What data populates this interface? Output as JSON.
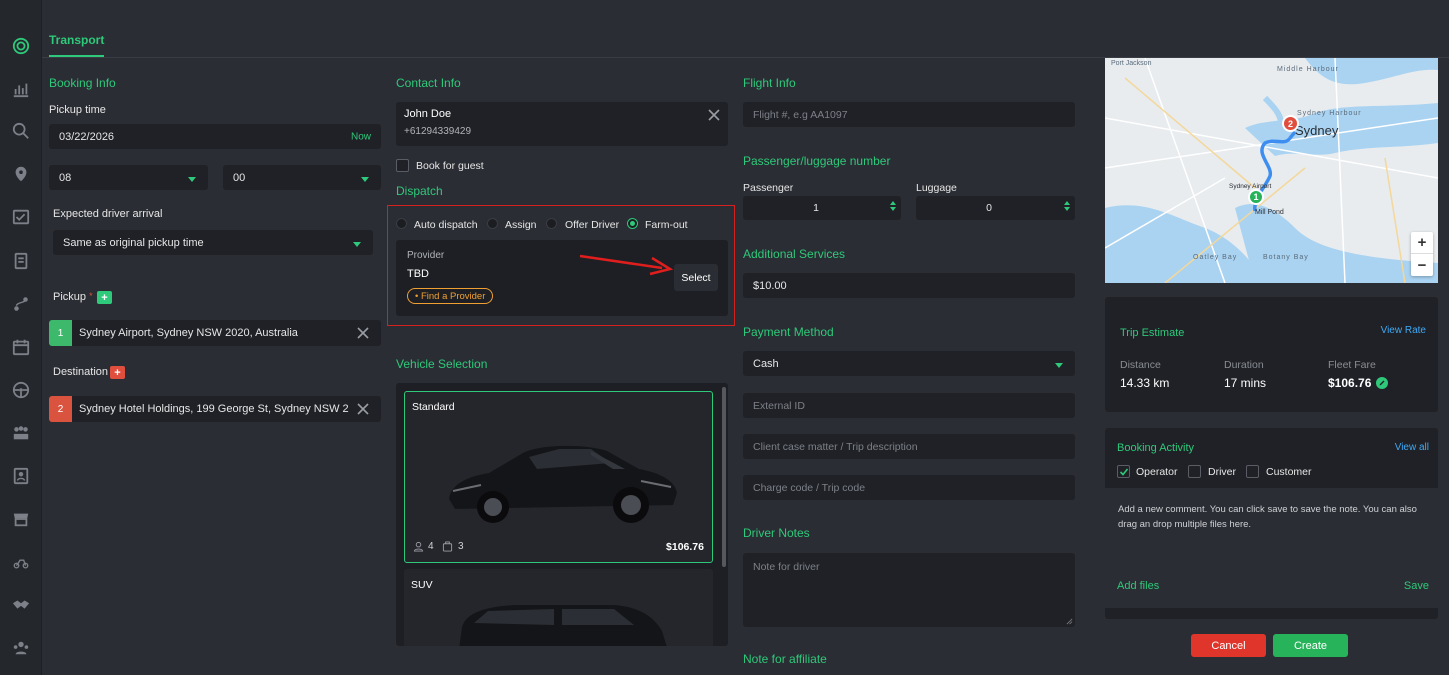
{
  "tab": {
    "label": "Transport"
  },
  "booking": {
    "title": "Booking Info",
    "pickup_time_label": "Pickup time",
    "date": "03/22/2026",
    "now": "Now",
    "hour": "08",
    "minute": "00",
    "arrival_label": "Expected driver arrival",
    "arrival_value": "Same as original pickup time",
    "pickup_label": "Pickup",
    "required": "*",
    "pickup_num": "1",
    "pickup_address": "Sydney Airport, Sydney NSW 2020, Australia",
    "destination_label": "Destination",
    "dest_num": "2",
    "dest_address": "Sydney Hotel Holdings, 199 George St, Sydney NSW 2000, A"
  },
  "contact": {
    "title": "Contact Info",
    "name": "John Doe",
    "phone": "+61294339429",
    "book_for_guest": "Book for guest"
  },
  "dispatch": {
    "title": "Dispatch",
    "options": [
      "Auto dispatch",
      "Assign",
      "Offer Driver",
      "Farm-out"
    ],
    "selected": "Farm-out",
    "provider_label": "Provider",
    "provider_value": "TBD",
    "find_provider": "• Find a Provider",
    "select_btn": "Select"
  },
  "vehicle": {
    "title": "Vehicle Selection",
    "items": [
      {
        "name": "Standard",
        "passengers": "4",
        "luggage": "3",
        "price": "$106.76"
      },
      {
        "name": "SUV"
      }
    ]
  },
  "flight": {
    "title": "Flight Info",
    "placeholder": "Flight #, e.g AA1097"
  },
  "passenger": {
    "title": "Passenger/luggage number",
    "passenger_label": "Passenger",
    "passenger_value": "1",
    "luggage_label": "Luggage",
    "luggage_value": "0"
  },
  "services": {
    "title": "Additional Services",
    "value": "$10.00"
  },
  "payment": {
    "title": "Payment Method",
    "value": "Cash",
    "external_id": "External ID",
    "client_case": "Client case matter / Trip description",
    "charge_code": "Charge code / Trip code"
  },
  "driver_notes": {
    "title": "Driver Notes",
    "placeholder": "Note for driver"
  },
  "affiliate": {
    "title": "Note for affiliate"
  },
  "map": {
    "labels": [
      "Middle Harbour",
      "Sydney Harbour",
      "Sydney",
      "Sydney Airport",
      "Mill Pond",
      "Botany Bay",
      "Botany Bay",
      "Oatley Bay",
      "Port Jackson"
    ],
    "zoom_in": "+",
    "zoom_out": "−",
    "marker1": "1",
    "marker2": "2"
  },
  "estimate": {
    "title": "Trip Estimate",
    "view_rate": "View Rate",
    "distance_label": "Distance",
    "distance": "14.33 km",
    "duration_label": "Duration",
    "duration": "17 mins",
    "fare_label": "Fleet Fare",
    "fare": "$106.76"
  },
  "activity": {
    "title": "Booking Activity",
    "view_all": "View all",
    "filters": [
      "Operator",
      "Driver",
      "Customer"
    ],
    "comment": "Add a new comment. You can click save to save the note. You can also drag an drop multiple files here.",
    "add_files": "Add files",
    "save": "Save"
  },
  "actions": {
    "cancel": "Cancel",
    "create": "Create"
  },
  "colors": {
    "accent": "#2ec97a",
    "danger": "#e04e3e",
    "link": "#3fa9f5",
    "warning": "#f0a030"
  }
}
